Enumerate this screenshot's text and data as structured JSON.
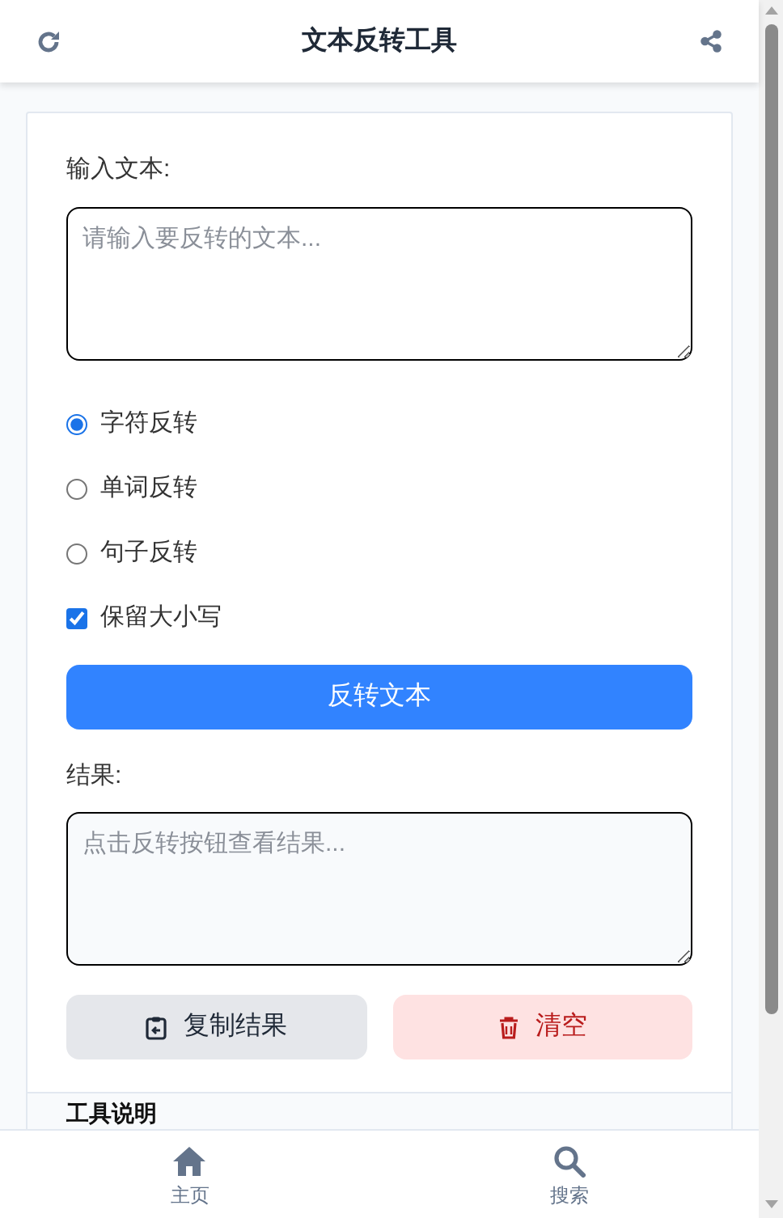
{
  "header": {
    "title": "文本反转工具"
  },
  "input": {
    "label": "输入文本:",
    "placeholder": "请输入要反转的文本..."
  },
  "modes": [
    {
      "label": "字符反转",
      "selected": true
    },
    {
      "label": "单词反转",
      "selected": false
    },
    {
      "label": "句子反转",
      "selected": false
    }
  ],
  "options": [
    {
      "label": "保留大小写",
      "checked": true
    }
  ],
  "reverse_button": "反转文本",
  "result": {
    "label": "结果:",
    "placeholder": "点击反转按钮查看结果..."
  },
  "actions": [
    {
      "kind": "copy",
      "label": "复制结果"
    },
    {
      "kind": "clear",
      "label": "清空"
    }
  ],
  "info_section": {
    "title": "工具说明"
  },
  "bottom_nav": [
    {
      "kind": "home",
      "label": "主页"
    },
    {
      "kind": "search",
      "label": "搜索"
    }
  ]
}
